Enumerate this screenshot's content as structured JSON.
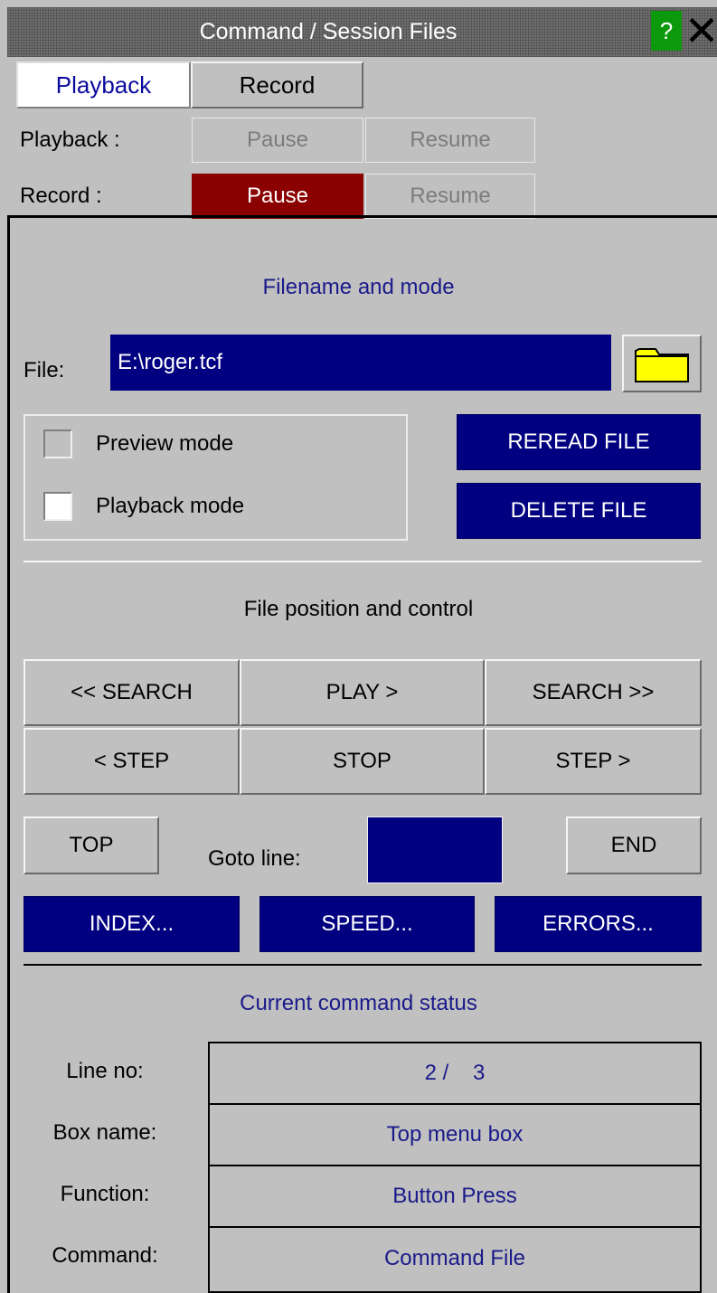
{
  "window": {
    "title": "Command / Session Files",
    "help_label": "?",
    "close_label": "✕"
  },
  "tabs": [
    {
      "label": "Playback",
      "active": true
    },
    {
      "label": "Record",
      "active": false
    }
  ],
  "controls": {
    "playback_label": "Playback :",
    "record_label": "Record :",
    "pause_label": "Pause",
    "resume_label": "Resume"
  },
  "filename_section": {
    "title": "Filename and mode",
    "file_label": "File:",
    "file_value": "E:\\roger.tcf",
    "folder_icon": "folder-icon",
    "preview_mode_label": "Preview mode",
    "preview_mode_checked": false,
    "playback_mode_label": "Playback mode",
    "playback_mode_checked": true,
    "reread_label": "REREAD FILE",
    "delete_label": "DELETE FILE"
  },
  "position_section": {
    "title": "File position and control",
    "search_back_label": "<< SEARCH",
    "play_label": "PLAY  >",
    "search_fwd_label": "SEARCH  >>",
    "step_back_label": "<  STEP",
    "stop_label": "STOP",
    "step_fwd_label": "STEP  >",
    "top_label": "TOP",
    "goto_label": "Goto line:",
    "goto_value": "",
    "end_label": "END",
    "index_label": "INDEX...",
    "speed_label": "SPEED...",
    "errors_label": "ERRORS..."
  },
  "status_section": {
    "title": "Current command status",
    "rows": [
      {
        "label": "Line no:",
        "value": "2 /    3"
      },
      {
        "label": "Box name:",
        "value": "Top menu box"
      },
      {
        "label": "Function:",
        "value": "Button Press"
      },
      {
        "label": "Command:",
        "value": "Command File"
      }
    ]
  },
  "colors": {
    "background": "#c0c0c0",
    "accent_blue": "#000080",
    "record_pause_red": "#8b0000",
    "help_green": "#0c9a0c",
    "text_blue": "#1a1a8a"
  }
}
